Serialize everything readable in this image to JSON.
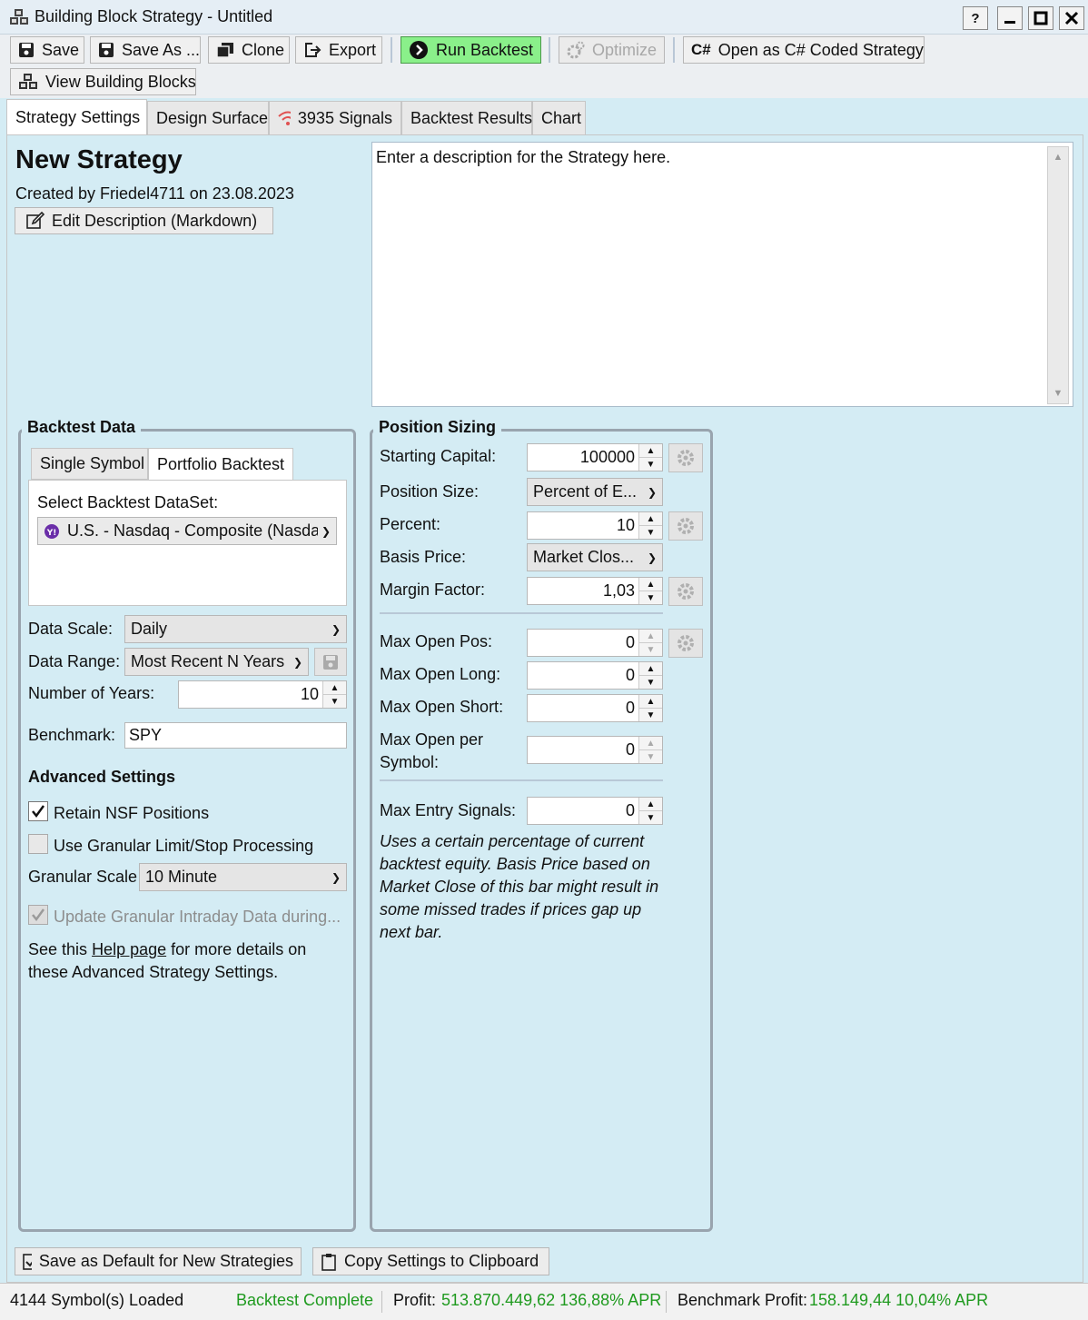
{
  "window": {
    "title": "Building Block Strategy - Untitled",
    "help_label": "?",
    "icon": "blocks-icon"
  },
  "toolbar": {
    "save": "Save",
    "save_as": "Save As ...",
    "clone": "Clone",
    "export": "Export",
    "run_backtest": "Run Backtest",
    "optimize": "Optimize",
    "open_csharp": "Open as C# Coded Strategy",
    "view_blocks": "View Building Blocks",
    "csharp_icon": "C#"
  },
  "tabs": {
    "strategy_settings": "Strategy Settings",
    "design_surface": "Design Surface",
    "signals": "3935 Signals",
    "backtest_results": "Backtest Results",
    "chart": "Chart"
  },
  "strategy": {
    "name": "New Strategy",
    "created": "Created by Friedel4711 on 23.08.2023",
    "edit_description": "Edit Description (Markdown)",
    "description": "Enter a description for the Strategy here."
  },
  "backtest_data": {
    "title": "Backtest Data",
    "tab_single": "Single Symbol",
    "tab_portfolio": "Portfolio Backtest",
    "select_label": "Select Backtest DataSet:",
    "dataset": "U.S. - Nasdaq - Composite (Nasda",
    "data_scale_label": "Data Scale:",
    "data_scale": "Daily",
    "data_range_label": "Data Range:",
    "data_range": "Most Recent N Years",
    "years_label": "Number of Years:",
    "years": "10",
    "benchmark_label": "Benchmark:",
    "benchmark": "SPY",
    "advanced_title": "Advanced Settings",
    "retain_nsf": "Retain NSF Positions",
    "retain_nsf_checked": true,
    "granular": "Use Granular Limit/Stop Processing",
    "granular_checked": false,
    "granular_scale_label": "Granular Scale",
    "granular_scale": "10 Minute",
    "update_granular": "Update Granular Intraday Data during...",
    "help_pre": "See this",
    "help_link": "Help page",
    "help_post": "for more details on",
    "help_line2": "these Advanced Strategy Settings."
  },
  "position_sizing": {
    "title": "Position Sizing",
    "starting_capital_label": "Starting Capital:",
    "starting_capital": "100000",
    "position_size_label": "Position Size:",
    "position_size": "Percent of E...",
    "percent_label": "Percent:",
    "percent": "10",
    "basis_price_label": "Basis Price:",
    "basis_price": "Market Clos...",
    "margin_label": "Margin Factor:",
    "margin": "1,03",
    "max_open_pos_label": "Max Open Pos:",
    "max_open_pos": "0",
    "max_open_long_label": "Max Open Long:",
    "max_open_long": "0",
    "max_open_short_label": "Max Open Short:",
    "max_open_short": "0",
    "max_open_symbol_label_1": "Max Open per",
    "max_open_symbol_label_2": "Symbol:",
    "max_open_symbol": "0",
    "max_entry_label": "Max Entry Signals:",
    "max_entry": "0",
    "note_lines": [
      "Uses a certain percentage of current",
      "backtest equity. Basis Price based on",
      "Market Close of this bar might result in",
      "some missed trades if prices gap up",
      "next bar."
    ]
  },
  "bottom": {
    "save_default": "Save as Default for New Strategies",
    "copy_settings": "Copy Settings to Clipboard"
  },
  "status": {
    "symbols": "4144 Symbol(s) Loaded",
    "backtest": "Backtest Complete",
    "profit_label": "Profit:",
    "profit": "513.870.449,62 136,88% APR",
    "benchmark_label": "Benchmark Profit:",
    "benchmark_profit": "158.149,44 10,04% APR"
  },
  "colors": {
    "run_button": "#8af08a",
    "background": "#d4ecf4",
    "status_green": "#1f9a1f"
  }
}
